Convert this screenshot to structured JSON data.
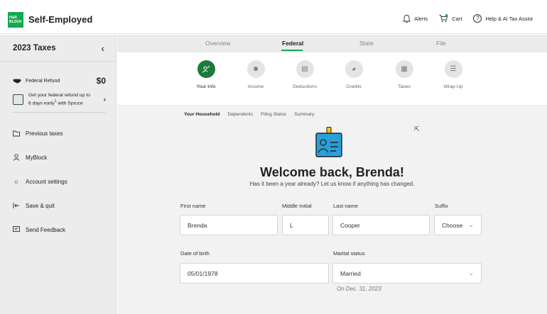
{
  "app": {
    "logo_line1": "H&R",
    "logo_line2": "BLOCK",
    "title": "Self-Employed"
  },
  "top_actions": {
    "alerts": "Alerts",
    "cart": "Cart",
    "help": "Help & AI Tax Assist"
  },
  "sidebar": {
    "title": "2023 Taxes",
    "refund_label": "Federal Refund",
    "refund_amount": "$0",
    "spruce_text_a": "Get your federal refund up to",
    "spruce_text_b": "6 days early",
    "spruce_sup": "1",
    "spruce_text_c": " with Spruce",
    "items": [
      {
        "label": "Previous taxes",
        "icon": "folder-icon"
      },
      {
        "label": "MyBlock",
        "icon": "person-icon"
      },
      {
        "label": "Account settings",
        "icon": "gear-icon"
      },
      {
        "label": "Save & quit",
        "icon": "exit-icon"
      },
      {
        "label": "Send Feedback",
        "icon": "feedback-icon"
      }
    ]
  },
  "tabs": [
    "Overview",
    "Federal",
    "State",
    "File"
  ],
  "active_tab": "Federal",
  "steps": [
    "Your Info",
    "Income",
    "Deductions",
    "Credits",
    "Taxes",
    "Wrap-Up"
  ],
  "active_step": "Your Info",
  "subnav": [
    "Your Household",
    "Dependents",
    "Filing Status",
    "Summary"
  ],
  "active_subnav": "Your Household",
  "welcome": {
    "title": "Welcome back, Brenda!",
    "subtitle": "Has it been a year already? Let us know if anything has changed."
  },
  "form": {
    "first_name_label": "First name",
    "first_name": "Brenda",
    "middle_initial_label": "Middle Initial",
    "middle_initial": "L",
    "last_name_label": "Last name",
    "last_name": "Cooper",
    "suffix_label": "Suffix",
    "suffix": "Choose",
    "dob_label": "Date of birth",
    "dob": "05/01/1978",
    "marital_label": "Marital status",
    "marital": "Married",
    "marital_note": "On Dec. 31, 2023"
  },
  "colors": {
    "brand_green": "#14a850",
    "active_step": "#1c7a3c"
  }
}
